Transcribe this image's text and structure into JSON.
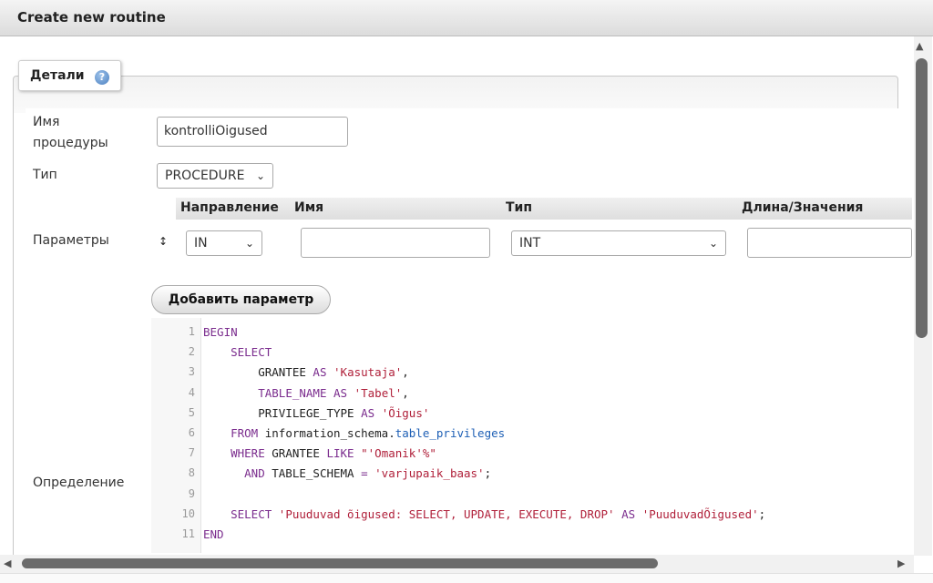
{
  "dialog": {
    "title": "Create new routine"
  },
  "details": {
    "legend": "Детали",
    "help_icon": "help-icon"
  },
  "form": {
    "name_label_1": "Имя",
    "name_label_2": "процедуры",
    "name_value": "kontrolliOigused",
    "type_label": "Тип",
    "type_value": "PROCEDURE",
    "params_label": "Параметры",
    "definition_label": "Определение",
    "add_param_button": "Добавить параметр"
  },
  "params_table": {
    "headers": [
      "Направление",
      "Имя",
      "Тип",
      "Длина/Значения"
    ],
    "row": {
      "direction": "IN",
      "name": "",
      "type": "INT",
      "length": ""
    }
  },
  "editor": {
    "line_numbers": [
      "1",
      "2",
      "3",
      "4",
      "5",
      "6",
      "7",
      "8",
      "9",
      "10",
      "11"
    ],
    "lines": [
      [
        {
          "t": "BEGIN",
          "c": "k"
        }
      ],
      [
        {
          "t": "    "
        },
        {
          "t": "SELECT",
          "c": "k"
        }
      ],
      [
        {
          "t": "        GRANTEE "
        },
        {
          "t": "AS",
          "c": "k"
        },
        {
          "t": " "
        },
        {
          "t": "'Kasutaja'",
          "c": "s"
        },
        {
          "t": ","
        }
      ],
      [
        {
          "t": "        "
        },
        {
          "t": "TABLE_NAME",
          "c": "k"
        },
        {
          "t": " "
        },
        {
          "t": "AS",
          "c": "k"
        },
        {
          "t": " "
        },
        {
          "t": "'Tabel'",
          "c": "s"
        },
        {
          "t": ","
        }
      ],
      [
        {
          "t": "        PRIVILEGE_TYPE "
        },
        {
          "t": "AS",
          "c": "k"
        },
        {
          "t": " "
        },
        {
          "t": "'Õigus'",
          "c": "s"
        }
      ],
      [
        {
          "t": "    "
        },
        {
          "t": "FROM",
          "c": "k"
        },
        {
          "t": " information_schema."
        },
        {
          "t": "table_privileges",
          "c": "v"
        }
      ],
      [
        {
          "t": "    "
        },
        {
          "t": "WHERE",
          "c": "k"
        },
        {
          "t": " GRANTEE "
        },
        {
          "t": "LIKE",
          "c": "k"
        },
        {
          "t": " "
        },
        {
          "t": "\"'Omanik'%\"",
          "c": "s"
        }
      ],
      [
        {
          "t": "      "
        },
        {
          "t": "AND",
          "c": "k"
        },
        {
          "t": " TABLE_SCHEMA "
        },
        {
          "t": "=",
          "c": "o"
        },
        {
          "t": " "
        },
        {
          "t": "'varjupaik_baas'",
          "c": "s"
        },
        {
          "t": ";"
        }
      ],
      [],
      [
        {
          "t": "    "
        },
        {
          "t": "SELECT",
          "c": "k"
        },
        {
          "t": " "
        },
        {
          "t": "'Puuduvad õigused: SELECT, UPDATE, EXECUTE, DROP'",
          "c": "s"
        },
        {
          "t": " "
        },
        {
          "t": "AS",
          "c": "k"
        },
        {
          "t": " "
        },
        {
          "t": "'PuuduvadÕigused'",
          "c": "s"
        },
        {
          "t": ";"
        }
      ],
      [
        {
          "t": "END",
          "c": "k"
        }
      ]
    ]
  }
}
